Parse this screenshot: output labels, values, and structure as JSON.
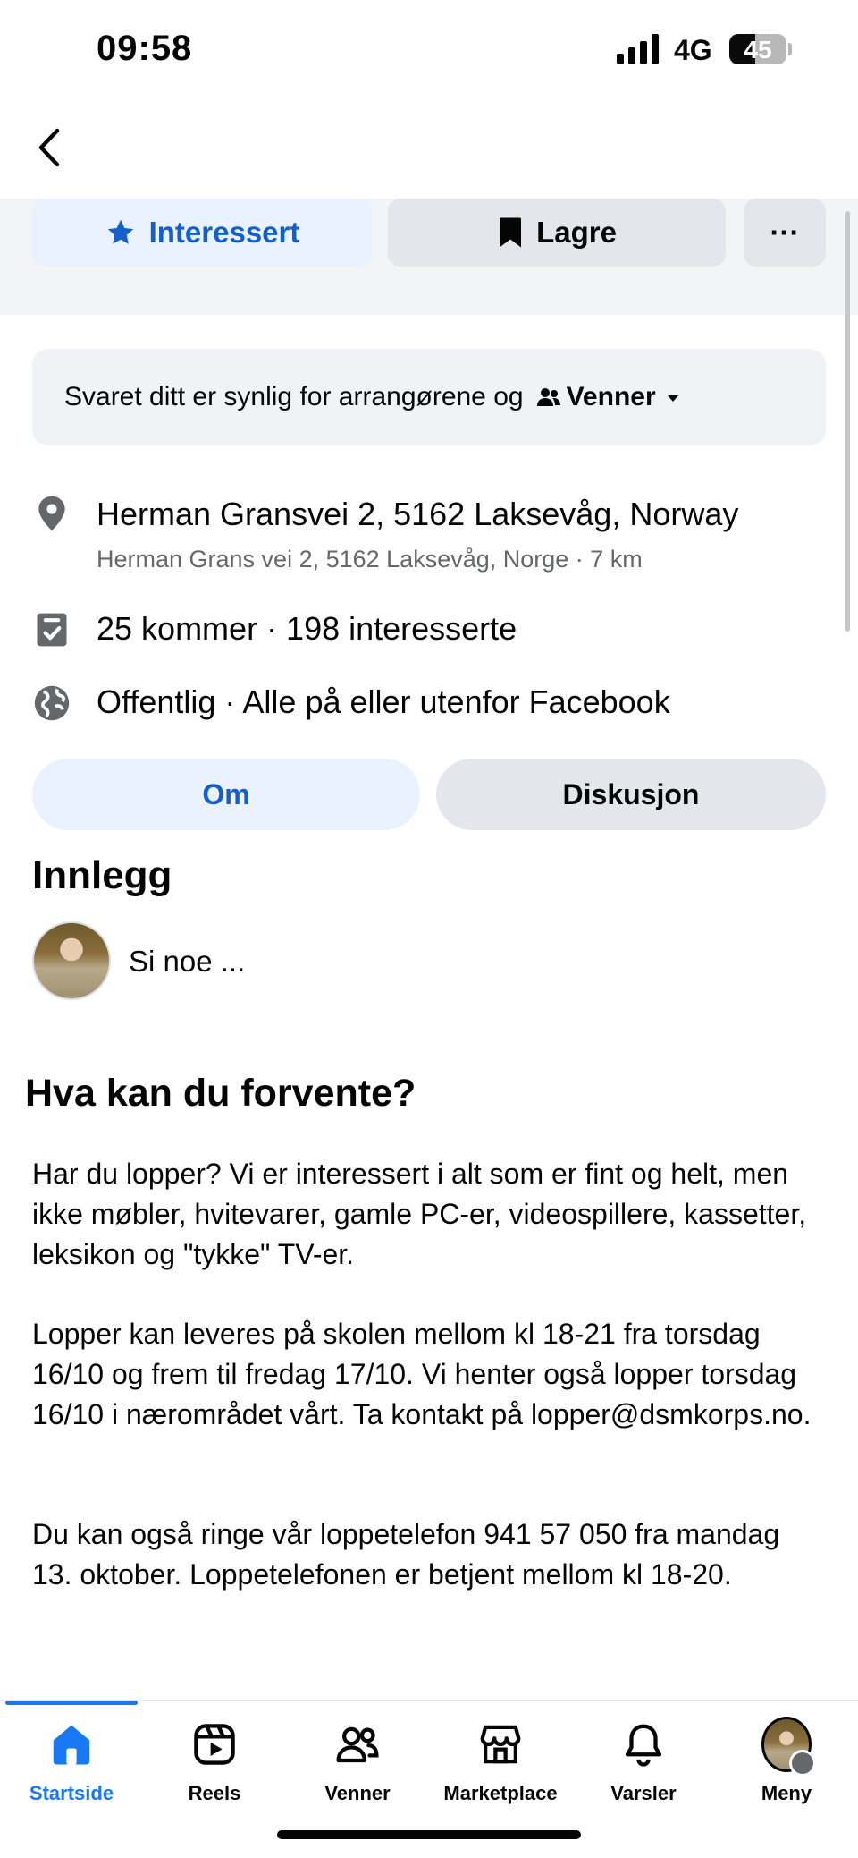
{
  "status_bar": {
    "time": "09:58",
    "network": "4G",
    "battery": "45",
    "battery_level": 0.45
  },
  "actions": {
    "interested_label": "Interessert",
    "save_label": "Lagre",
    "more_label": "···"
  },
  "notice": {
    "text": "Svaret ditt er synlig for arrangørene og",
    "audience": "Venner"
  },
  "location": {
    "main": "Herman Gransvei 2, 5162 Laksevåg, Norway",
    "sub": "Herman Grans vei 2, 5162 Laksevåg, Norge · 7 km"
  },
  "attendance": "25 kommer · 198 interesserte",
  "privacy": "Offentlig · Alle på eller utenfor Facebook",
  "tabs": [
    {
      "label": "Om"
    },
    {
      "label": "Diskusjon"
    }
  ],
  "posts": {
    "heading": "Innlegg",
    "composer_placeholder": "Si noe ..."
  },
  "about": {
    "heading": "Hva kan du forvente?",
    "paragraphs": [
      "Har du lopper? Vi er interessert i alt som er fint og helt, men ikke møbler, hvitevarer, gamle PC-er, videospillere, kassetter, leksikon og \"tykke\" TV-er.",
      "Lopper kan leveres på skolen mellom kl 18-21 fra torsdag 16/10 og frem til fredag 17/10. Vi henter også lopper torsdag 16/10 i nærområdet vårt. Ta kontakt på lopper@dsmkorps.no.",
      "Du kan også ringe vår loppetelefon 941 57 050 fra mandag 13. oktober. Loppetelefonen er betjent mellom kl 18-20."
    ]
  },
  "nav": [
    {
      "label": "Startside",
      "icon": "home-icon"
    },
    {
      "label": "Reels",
      "icon": "reels-icon"
    },
    {
      "label": "Venner",
      "icon": "friends-icon"
    },
    {
      "label": "Marketplace",
      "icon": "marketplace-icon"
    },
    {
      "label": "Varsler",
      "icon": "bell-icon"
    },
    {
      "label": "Meny",
      "icon": "profile-avatar"
    }
  ],
  "colors": {
    "accent": "#1877f2",
    "accent_text": "#1260c8",
    "light_blue": "#e9f2fe",
    "gray_button": "#e4e6eb",
    "secondary_text": "#65676b"
  }
}
